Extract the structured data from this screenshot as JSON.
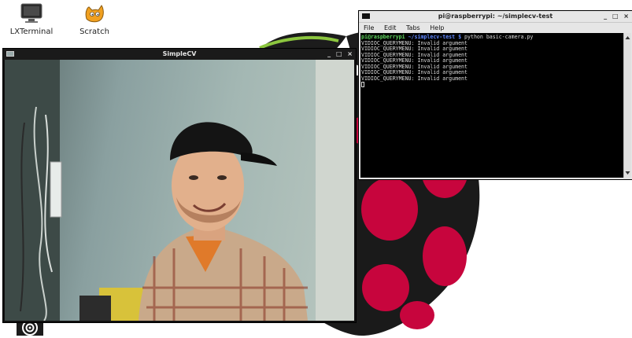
{
  "desktop": {
    "icons": [
      {
        "label": "LXTerminal",
        "icon": "monitor-icon"
      },
      {
        "label": "Scratch",
        "icon": "scratch-cat-icon"
      },
      {
        "label": "",
        "icon": "target-icon"
      }
    ]
  },
  "colors": {
    "raspberry_red": "#c7053d",
    "raspberry_leaf": "#1c1c1c",
    "terminal_bg": "#000000",
    "prompt_user": "#5fd75f",
    "prompt_path": "#5f87ff"
  },
  "simplecv_window": {
    "title": "SimpleCV",
    "controls": [
      "_",
      "□",
      "×"
    ]
  },
  "terminal_window": {
    "title": "pi@raspberrypi: ~/simplecv-test",
    "controls": [
      "_",
      "□",
      "×"
    ],
    "menu": [
      "File",
      "Edit",
      "Tabs",
      "Help"
    ],
    "prompt_user": "pi@raspberrypi",
    "prompt_path": "~/simplecv-test $",
    "command": "python basic-camera.py",
    "output": [
      "VIDIOC_QUERYMENU: Invalid argument",
      "VIDIOC_QUERYMENU: Invalid argument",
      "VIDIOC_QUERYMENU: Invalid argument",
      "VIDIOC_QUERYMENU: Invalid argument",
      "VIDIOC_QUERYMENU: Invalid argument",
      "VIDIOC_QUERYMENU: Invalid argument",
      "VIDIOC_QUERYMENU: Invalid argument"
    ]
  }
}
